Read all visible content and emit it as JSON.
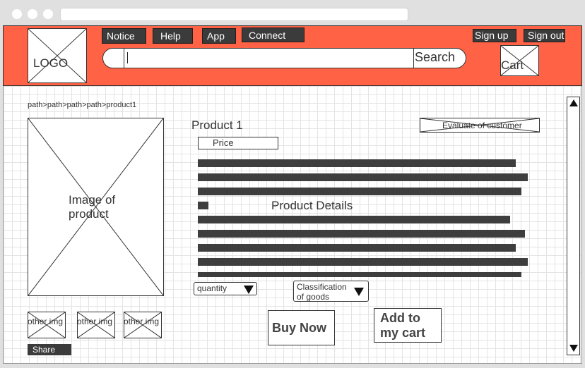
{
  "header": {
    "logo_label": "LOGO",
    "nav": {
      "notice": "Notice",
      "help": "Help",
      "app": "App",
      "connect": "Connect",
      "sign_up": "Sign up",
      "sign_out": "Sign out"
    },
    "search": {
      "value": "",
      "button_label": "Search"
    },
    "cart_label": "Cart",
    "accent_color": "#ff6244"
  },
  "breadcrumb": "path>path>path>path>product1",
  "product": {
    "image_label": "Image of product",
    "thumbnails": [
      "other img",
      "other img",
      "other img"
    ],
    "share_label": "Share",
    "title": "Product 1",
    "price_label": "Price",
    "evaluate_label": "Evaluate of customer",
    "details_label": "Product Details"
  },
  "selectors": {
    "quantity_label": "quantity",
    "classification_label": "Classification of goods"
  },
  "actions": {
    "buy_now": "Buy Now",
    "add_to_cart": "Add to my cart"
  },
  "icons": {
    "scroll_up": "triangle-up-icon",
    "scroll_down": "triangle-down-icon",
    "dropdown": "triangle-down-icon"
  }
}
